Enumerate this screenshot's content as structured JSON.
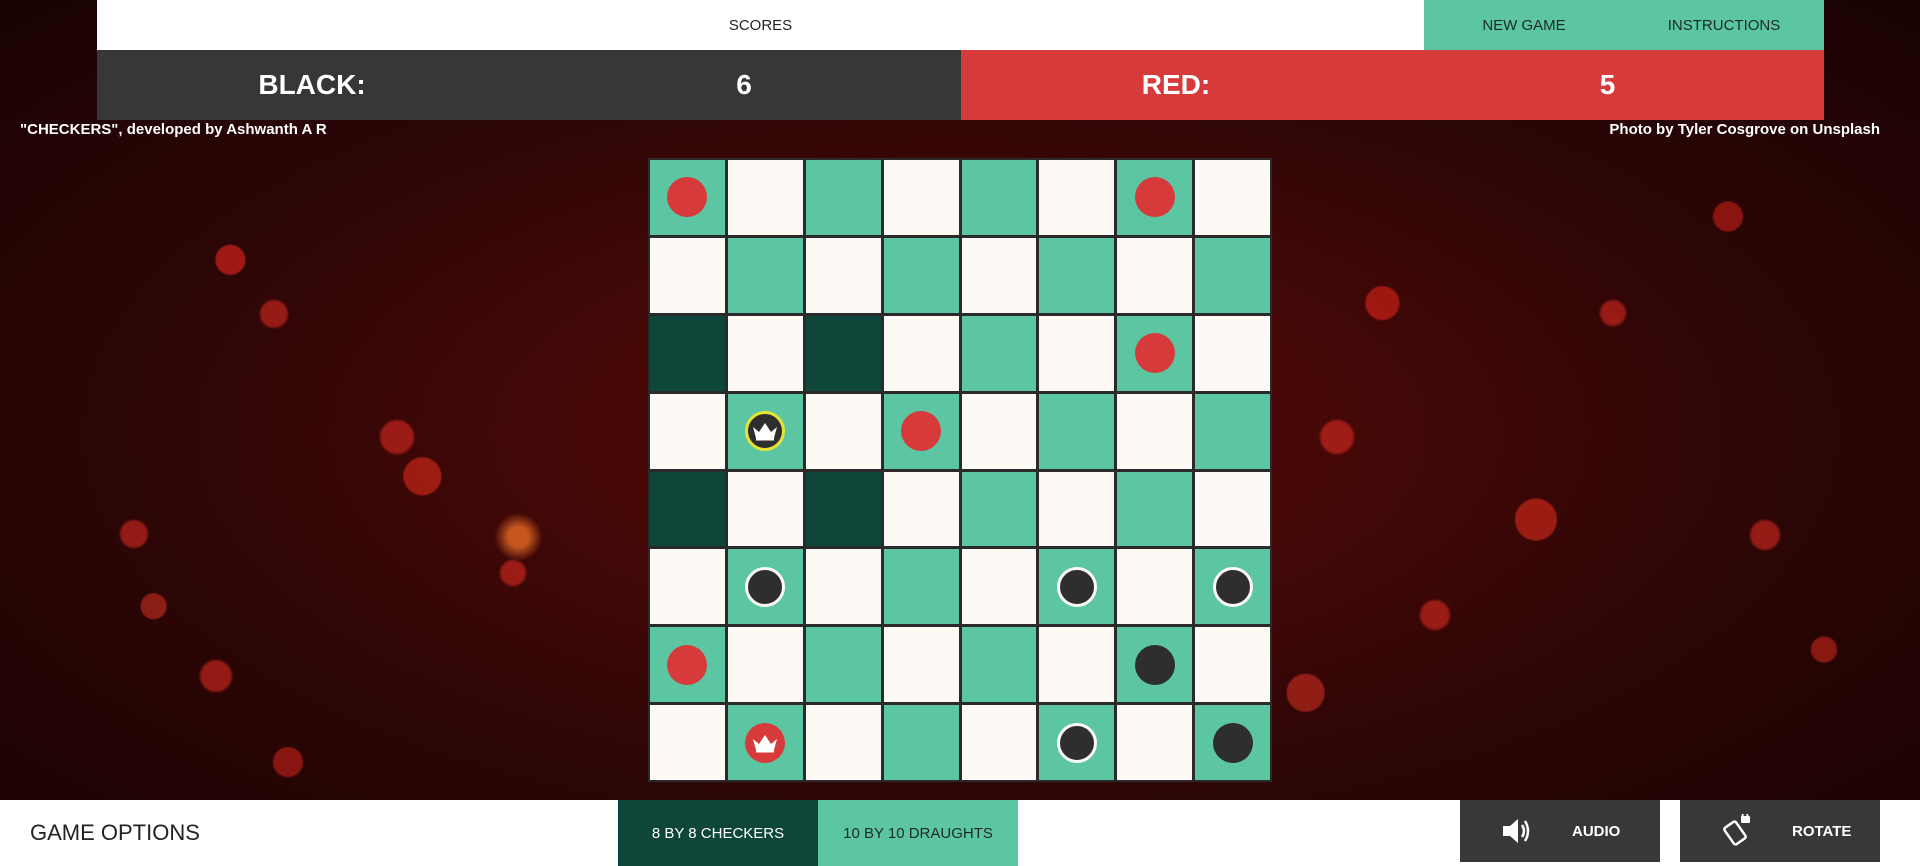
{
  "header": {
    "scores_tab": "SCORES",
    "new_game": "NEW GAME",
    "instructions": "INSTRUCTIONS"
  },
  "scoreboard": {
    "black_label": "BLACK:",
    "black_score": "6",
    "red_label": "RED:",
    "red_score": "5"
  },
  "credits": {
    "developer": "\"CHECKERS\", developed by Ashwanth A R",
    "photo": "Photo by Tyler Cosgrove on Unsplash"
  },
  "board": {
    "size": 8,
    "rows": [
      [
        "red",
        "",
        "",
        "",
        "",
        "",
        "red",
        ""
      ],
      [
        "",
        "",
        "",
        "",
        "",
        "",
        "",
        ""
      ],
      [
        "",
        "",
        "",
        "",
        "",
        "",
        "red",
        ""
      ],
      [
        "",
        "black-king-selected",
        "",
        "red",
        "",
        "",
        "",
        ""
      ],
      [
        "",
        "",
        "",
        "",
        "",
        "",
        "",
        ""
      ],
      [
        "",
        "black",
        "",
        "",
        "",
        "black",
        "",
        "black"
      ],
      [
        "red",
        "",
        "",
        "",
        "",
        "",
        "black-flat",
        ""
      ],
      [
        "",
        "red-king",
        "",
        "",
        "",
        "black",
        "",
        "black-flat"
      ]
    ],
    "highlighted_cells": [
      [
        2,
        0
      ],
      [
        2,
        2
      ],
      [
        4,
        0
      ],
      [
        4,
        2
      ]
    ],
    "colors": {
      "light": "#fdfaf5",
      "dark": "#5cc6a3",
      "highlight": "#0f463a",
      "red_piece": "#d73a3a",
      "black_piece": "#2e2e2e",
      "selected_ring": "#e8e235"
    }
  },
  "footer": {
    "title": "GAME OPTIONS",
    "mode_8": "8 BY 8 CHECKERS",
    "mode_10": "10 BY 10 DRAUGHTS",
    "audio": "AUDIO",
    "audio_icon": "speaker-icon",
    "rotate": "ROTATE",
    "rotate_icon": "rotate-device-icon"
  }
}
